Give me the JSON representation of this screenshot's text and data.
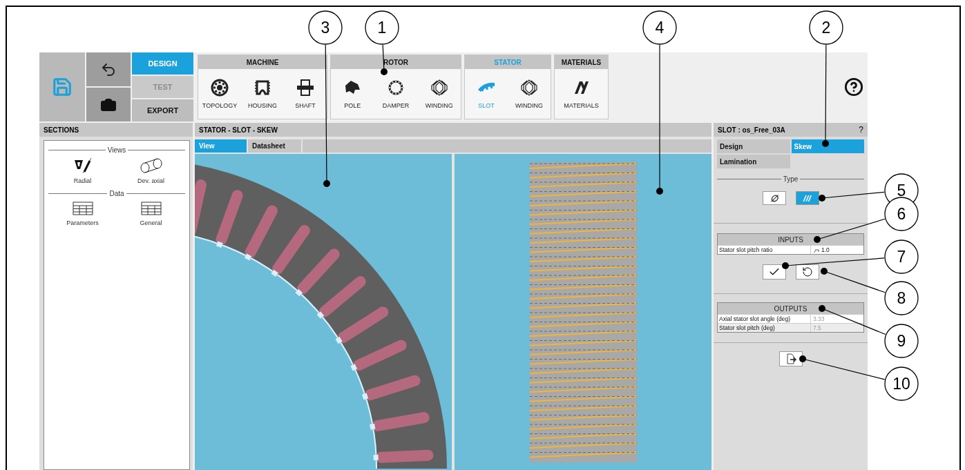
{
  "toolbar": {
    "modes": [
      {
        "label": "DESIGN",
        "selected": true,
        "disabled": false
      },
      {
        "label": "TEST",
        "selected": false,
        "disabled": true
      },
      {
        "label": "EXPORT",
        "selected": false,
        "disabled": false
      }
    ],
    "groups": [
      {
        "title": "MACHINE",
        "selected": false,
        "items": [
          {
            "label": "TOPOLOGY",
            "kind": "topology",
            "selected": false
          },
          {
            "label": "HOUSING",
            "kind": "housing",
            "selected": false
          },
          {
            "label": "SHAFT",
            "kind": "shaft",
            "selected": false
          }
        ]
      },
      {
        "title": "ROTOR",
        "selected": false,
        "items": [
          {
            "label": "POLE",
            "kind": "pole",
            "selected": false
          },
          {
            "label": "DAMPER",
            "kind": "damper",
            "selected": false
          },
          {
            "label": "WINDING",
            "kind": "winding",
            "selected": false
          }
        ]
      },
      {
        "title": "STATOR",
        "selected": true,
        "items": [
          {
            "label": "SLOT",
            "kind": "slot",
            "selected": true
          },
          {
            "label": "WINDING",
            "kind": "winding",
            "selected": false
          }
        ]
      },
      {
        "title": "MATERIALS",
        "selected": false,
        "items": [
          {
            "label": "MATERIALS",
            "kind": "materials",
            "selected": false
          }
        ]
      }
    ]
  },
  "sections": {
    "title": "SECTIONS",
    "groups": [
      {
        "title": "Views",
        "items": [
          {
            "label": "Radial",
            "kind": "radial"
          },
          {
            "label": "Dev. axial",
            "kind": "axial"
          }
        ]
      },
      {
        "title": "Data",
        "items": [
          {
            "label": "Parameters",
            "kind": "table"
          },
          {
            "label": "General",
            "kind": "table"
          }
        ]
      }
    ]
  },
  "main": {
    "title": "STATOR - SLOT - SKEW",
    "tabs": [
      {
        "label": "View",
        "selected": true
      },
      {
        "label": "Datasheet",
        "selected": false
      }
    ]
  },
  "slot_panel": {
    "title": "SLOT : os_Free_03A",
    "help": "?",
    "tabs": [
      {
        "label": "Design",
        "selected": false
      },
      {
        "label": "Skew",
        "selected": true
      },
      {
        "label": "Lamination",
        "selected": false
      }
    ],
    "type": {
      "title": "Type",
      "options": [
        {
          "symbol": "∅",
          "selected": false
        },
        {
          "symbol": "///",
          "selected": true
        }
      ]
    },
    "inputs": {
      "title": "INPUTS",
      "rows": [
        {
          "label": "Stator slot pitch ratio",
          "value": "1.0"
        }
      ]
    },
    "outputs": {
      "title": "OUTPUTS",
      "rows": [
        {
          "label": "Axial stator slot angle (deg)",
          "value": "3.33"
        },
        {
          "label": "Stator slot pitch (deg)",
          "value": "7.5"
        }
      ]
    }
  },
  "callouts": [
    "3",
    "1",
    "4",
    "2",
    "5",
    "6",
    "7",
    "8",
    "9",
    "10"
  ]
}
